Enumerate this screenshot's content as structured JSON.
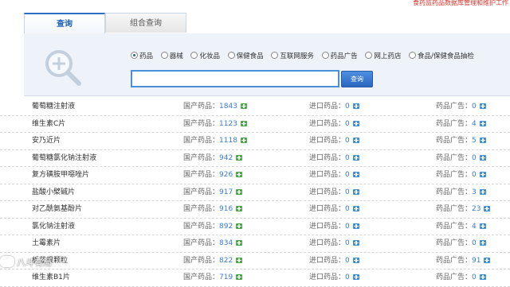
{
  "top_notice": "食药监药品数据库管理和维护工作",
  "tabs": [
    {
      "label": "查询",
      "active": true
    },
    {
      "label": "组合查询",
      "active": false
    }
  ],
  "search": {
    "options": [
      "药品",
      "器械",
      "化妆品",
      "保健食品",
      "互联网服务",
      "药品广告",
      "网上药店",
      "食品/保健食品抽检"
    ],
    "selected": "药品",
    "input_value": "",
    "button_label": "查询"
  },
  "labels": {
    "domestic": "国产药品：",
    "imported": "进口药品：",
    "ads": "药品广告："
  },
  "results": [
    {
      "name": "葡萄糖注射液",
      "domestic": "1843",
      "imported": "0",
      "ads": "0"
    },
    {
      "name": "维生素C片",
      "domestic": "1123",
      "imported": "0",
      "ads": "4"
    },
    {
      "name": "安乃近片",
      "domestic": "1118",
      "imported": "0",
      "ads": "5"
    },
    {
      "name": "葡萄糖氯化钠注射液",
      "domestic": "942",
      "imported": "0",
      "ads": "0"
    },
    {
      "name": "复方磺胺甲噁唑片",
      "domestic": "926",
      "imported": "0",
      "ads": "0"
    },
    {
      "name": "盐酸小檗碱片",
      "domestic": "917",
      "imported": "0",
      "ads": "3"
    },
    {
      "name": "对乙酰氨基酚片",
      "domestic": "916",
      "imported": "0",
      "ads": "23"
    },
    {
      "name": "氯化钠注射液",
      "domestic": "892",
      "imported": "0",
      "ads": "4"
    },
    {
      "name": "土霉素片",
      "domestic": "834",
      "imported": "0",
      "ads": "0"
    },
    {
      "name": "板蓝根颗粒",
      "domestic": "822",
      "imported": "0",
      "ads": "91"
    },
    {
      "name": "维生素B1片",
      "domestic": "719",
      "imported": "0",
      "ads": "0"
    }
  ],
  "watermark": "八斗有局"
}
